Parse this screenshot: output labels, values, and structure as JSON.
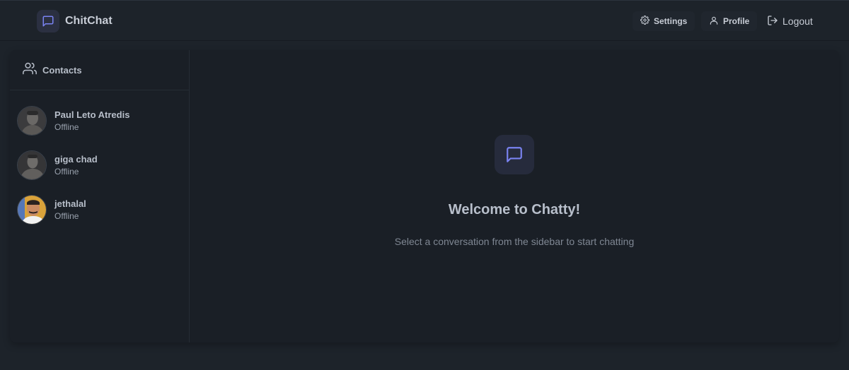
{
  "app": {
    "name": "ChitChat",
    "brand_icon": "message-square-icon"
  },
  "nav": {
    "settings_label": "Settings",
    "profile_label": "Profile",
    "logout_label": "Logout"
  },
  "sidebar": {
    "title": "Contacts",
    "contacts": [
      {
        "name": "Paul Leto Atredis",
        "status": "Offline"
      },
      {
        "name": "giga chad",
        "status": "Offline"
      },
      {
        "name": "jethalal",
        "status": "Offline"
      }
    ]
  },
  "main": {
    "title": "Welcome to Chatty!",
    "subtitle": "Select a conversation from the sidebar to start chatting"
  },
  "colors": {
    "background": "#1d232a",
    "panel": "#1a1f26",
    "accent": "#7a83f2",
    "text": "#a6adbb"
  }
}
